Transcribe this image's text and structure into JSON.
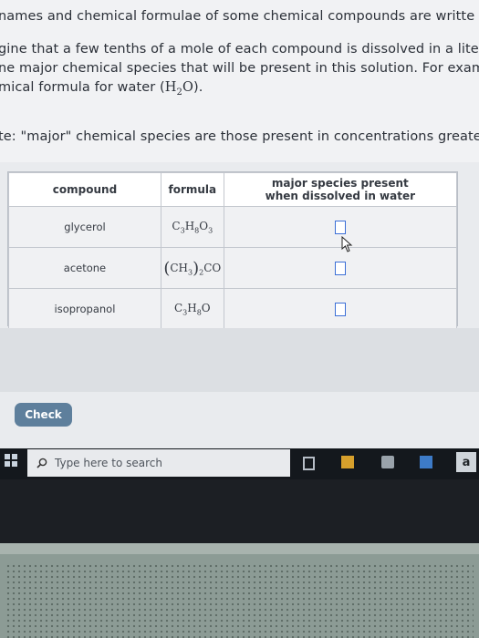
{
  "intro": {
    "line1": "names and chemical formulae of some chemical compounds are writte",
    "line2": "gine that a few tenths of a mole of each compound is dissolved in a lite",
    "line3": "ne major chemical species that will be present in this solution. For exam",
    "line4_prefix": "mical formula for water (",
    "h2o_h": "H",
    "h2o_sub": "2",
    "h2o_o": "O",
    "line4_suffix": ").",
    "line5": "te: \"major\" chemical species are those present in concentrations greater t"
  },
  "table": {
    "headers": {
      "compound": "compound",
      "formula": "formula",
      "major_line1": "major species present",
      "major_line2": "when dissolved in water"
    },
    "rows": [
      {
        "compound": "glycerol",
        "f": [
          "C",
          "3",
          "H",
          "8",
          "O",
          "3"
        ]
      },
      {
        "compound": "acetone",
        "f_open": "(",
        "f_ch": "CH",
        "f_ch_sub": "3",
        "f_close": ")",
        "f_close_sub": "2",
        "f_co": "CO"
      },
      {
        "compound": "isopropanol",
        "f": [
          "C",
          "3",
          "H",
          "8",
          "O",
          ""
        ]
      }
    ]
  },
  "check_button": "Check",
  "taskbar": {
    "search_placeholder": "Type here to search",
    "app_letter": "a"
  },
  "colors": {
    "accent_box": "#3b6fd6",
    "check_button": "#5e7f9c",
    "taskbar": "#14181d"
  }
}
